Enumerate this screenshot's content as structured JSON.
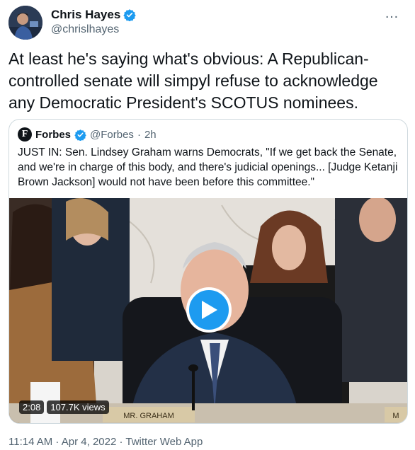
{
  "author": {
    "name": "Chris Hayes",
    "handle": "@chrislhayes",
    "verified": true,
    "avatar_icon": "avatar-photo"
  },
  "more_icon": "…",
  "tweet": {
    "text": "At least he's saying what's obvious: A Republican-controlled senate will simpyl refuse to acknowledge any Democratic President's SCOTUS nominees."
  },
  "quote": {
    "logo_letter": "F",
    "name": "Forbes",
    "verified": true,
    "handle": "@Forbes",
    "separator": "·",
    "time": "2h",
    "text": "JUST IN: Sen. Lindsey Graham warns Democrats, \"If we get back the Senate, and we're in charge of this body, and there's judicial openings... [Judge Ketanji Brown Jackson] would not have been before this committee.\"",
    "video": {
      "duration": "2:08",
      "views": "107.7K views",
      "nameplate": "MR. GRAHAM",
      "nameplate_right": "M"
    }
  },
  "footer": {
    "meta": "11:14 AM · Apr 4, 2022 · Twitter Web App"
  },
  "colors": {
    "accent": "#1d9bf0",
    "text": "#0f1419",
    "muted": "#536471",
    "border": "#cfd9de"
  }
}
